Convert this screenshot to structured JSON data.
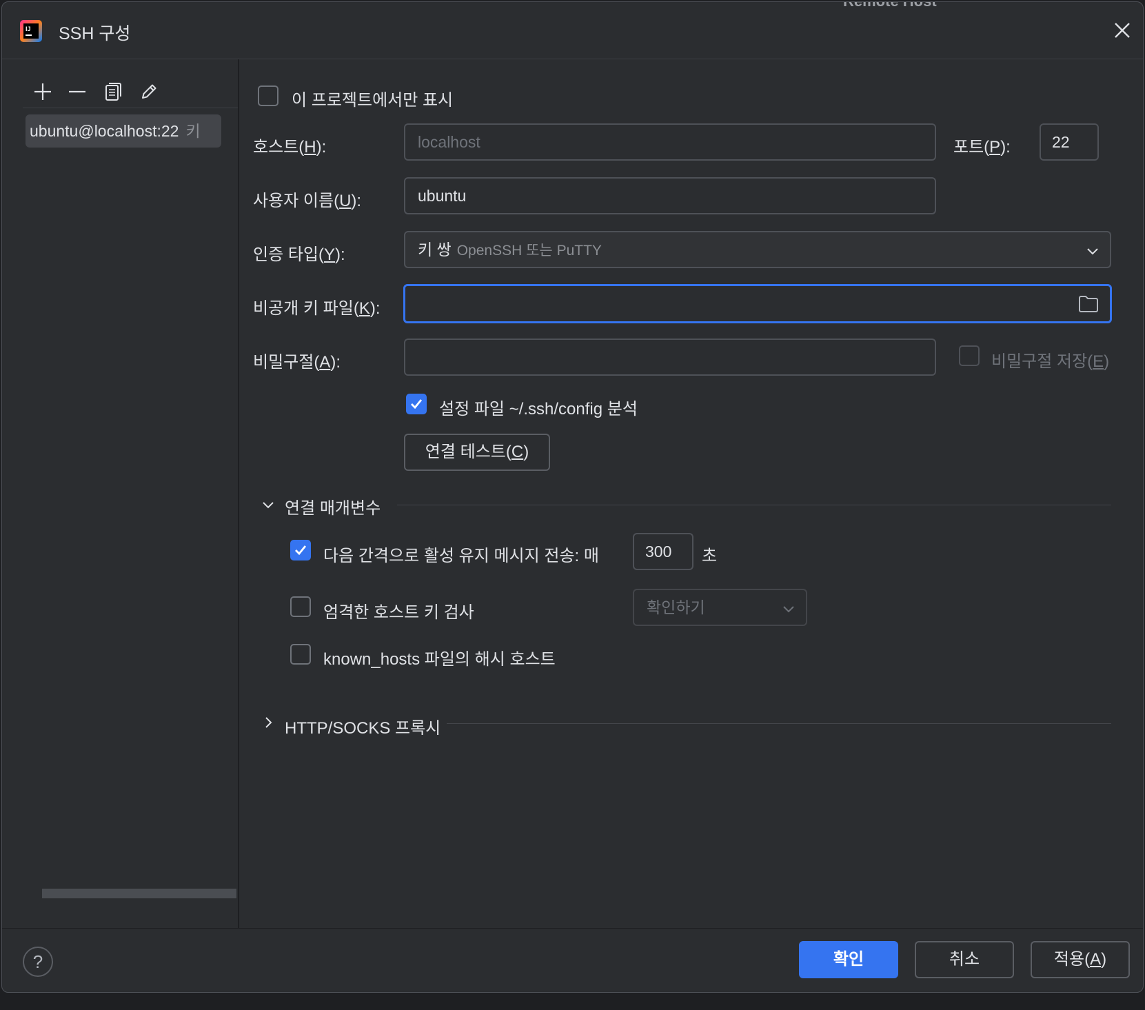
{
  "window": {
    "title": "SSH 구성",
    "background_tab_text": "Remote Host"
  },
  "left_panel": {
    "toolbar": [
      "add-icon",
      "remove-icon",
      "copy-icon",
      "edit-icon"
    ],
    "hosts": [
      {
        "label": "ubuntu@localhost:22",
        "hint": "키"
      }
    ]
  },
  "form": {
    "project_only": {
      "label": "이 프로젝트에서만 표시",
      "checked": false
    },
    "host": {
      "label": "호스트",
      "mnemonic": "H",
      "value": "localhost"
    },
    "port": {
      "label": "포트",
      "mnemonic": "P",
      "value": "22"
    },
    "username": {
      "label": "사용자 이름",
      "mnemonic": "U",
      "value": "ubuntu"
    },
    "auth_type": {
      "label": "인증 타입",
      "mnemonic": "Y",
      "value": "키 쌍",
      "hint": "OpenSSH 또는 PuTTY"
    },
    "private_key": {
      "label": "비공개 키 파일",
      "mnemonic": "K",
      "value": ""
    },
    "passphrase": {
      "label": "비밀구절",
      "mnemonic": "A",
      "value": ""
    },
    "save_passphrase": {
      "label": "비밀구절 저장",
      "mnemonic": "E",
      "checked": false,
      "enabled": false
    },
    "parse_config": {
      "label": "설정 파일 ~/.ssh/config 분석",
      "checked": true
    },
    "test_connection": {
      "label": "연결 테스트",
      "mnemonic": "C"
    }
  },
  "connection_params": {
    "title": "연결 매개변수",
    "expanded": true,
    "keepalive": {
      "label": "다음 간격으로 활성 유지 메시지 전송: 매",
      "value": "300",
      "unit": "초",
      "checked": true
    },
    "strict_host_key": {
      "label": "엄격한 호스트 키 검사",
      "checked": false,
      "select_value": "확인하기"
    },
    "hash_hosts": {
      "label": "known_hosts 파일의 해시 호스트",
      "checked": false
    }
  },
  "proxy": {
    "title": "HTTP/SOCKS 프록시",
    "expanded": false
  },
  "footer": {
    "help": "?",
    "ok": "확인",
    "cancel": "취소",
    "apply": "적용",
    "apply_mnemonic": "A"
  },
  "colors": {
    "accent": "#3574f0",
    "dialog_bg": "#2b2d30",
    "outer_bg": "#1e1f22",
    "border": "#4e5157"
  }
}
